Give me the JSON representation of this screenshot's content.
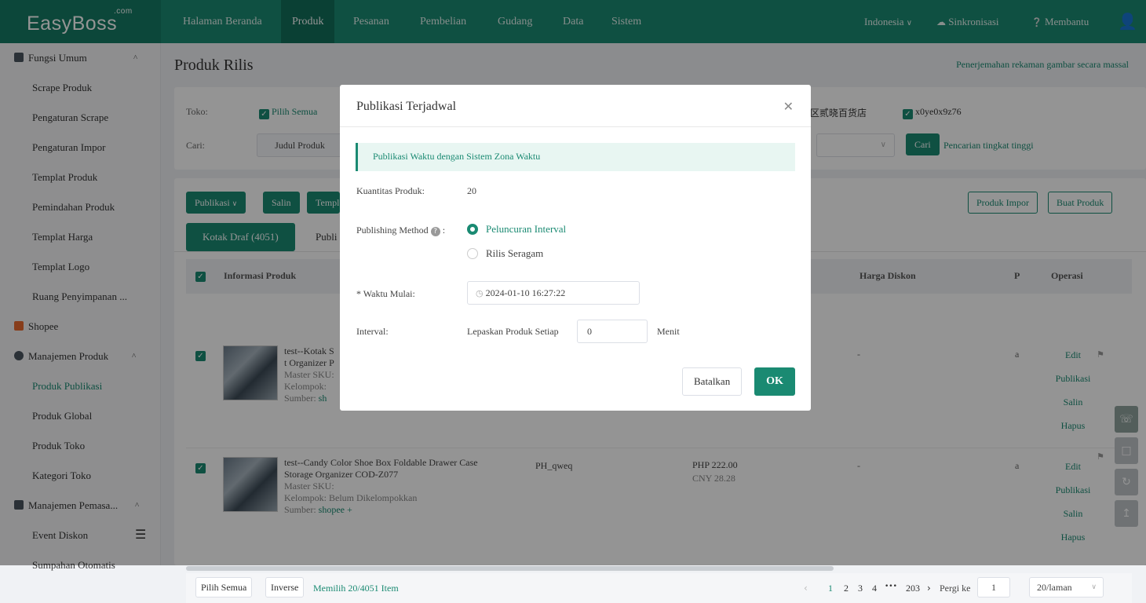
{
  "brand": {
    "name": "EasyBoss",
    "suffix": ".com"
  },
  "nav": {
    "items": [
      "Halaman Beranda",
      "Produk",
      "Pesanan",
      "Pembelian",
      "Gudang",
      "Data",
      "Sistem"
    ],
    "active": "Produk",
    "language": "Indonesia",
    "sync": "Sinkronisasi",
    "help": "Membantu"
  },
  "sidebar": {
    "groups": [
      {
        "label": "Fungsi Umum",
        "items": [
          "Scrape Produk",
          "Pengaturan Scrape",
          "Pengaturan Impor",
          "Templat Produk",
          "Pemindahan Produk",
          "Templat Harga",
          "Templat Logo",
          "Ruang Penyimpanan ..."
        ]
      },
      {
        "label": "Shopee",
        "items": []
      },
      {
        "label": "Manajemen Produk",
        "items": [
          "Produk Publikasi",
          "Produk Global",
          "Produk Toko",
          "Kategori Toko"
        ]
      },
      {
        "label": "Manajemen Pemasa...",
        "items": [
          "Event Diskon",
          "Sumpahan Otomatis"
        ]
      }
    ],
    "active": "Produk Publikasi"
  },
  "page": {
    "title": "Produk Rilis",
    "top_link": "Penerjemahan rekaman gambar secara massal"
  },
  "filter": {
    "store_label": "Toko:",
    "select_all": "Pilih Semua",
    "store2": "区贰晓百货店",
    "store3": "x0ye0x9z76",
    "search_label": "Cari:",
    "search_field": "Judul Produk",
    "search_btn": "Cari",
    "advanced": "Pencarian tingkat tinggi"
  },
  "toolbar": {
    "publish": "Publikasi",
    "copy": "Salin",
    "template": "Templ",
    "import": "Produk Impor",
    "create": "Buat Produk"
  },
  "tabs": {
    "draft": "Kotak Draf (4051)",
    "pub": "Publi"
  },
  "table": {
    "headers": {
      "info": "Informasi Produk",
      "disc": "Harga Diskon",
      "p": "P",
      "ops": "Operasi"
    },
    "rows": [
      {
        "title": "test--Kotak S",
        "title2": "t Organizer P",
        "sku": "Master SKU:",
        "group": "Kelompok:",
        "source_label": "Sumber:",
        "source": "sh",
        "sku_code": "",
        "price": "",
        "cny": "",
        "disc": "-",
        "p": "a"
      },
      {
        "title": "test--Candy Color Shoe Box Foldable Drawer Case",
        "title2": "Storage Organizer COD-Z077",
        "sku": "Master SKU:",
        "group": "Kelompok:  Belum Dikelompokkan",
        "source_label": "Sumber:",
        "source": "shopee  +",
        "sku_code": "PH_qweq",
        "price": "PHP 222.00",
        "cny": "CNY 28.28",
        "disc": "-",
        "p": "a"
      }
    ],
    "ops": [
      "Edit",
      "Publikasi",
      "Salin",
      "Hapus"
    ]
  },
  "footer": {
    "select_all": "Pilih Semua",
    "inverse": "Inverse",
    "selected": "Memilih 20/4051 Item",
    "pages": [
      "1",
      "2",
      "3",
      "4",
      "•••",
      "203"
    ],
    "goto": "Pergi ke",
    "goto_val": "1",
    "per_page": "20/laman"
  },
  "modal": {
    "title": "Publikasi Terjadwal",
    "alert": "Publikasi Waktu dengan Sistem Zona Waktu",
    "qty_label": "Kuantitas Produk:",
    "qty": "20",
    "method_label": "Publishing Method",
    "method_opt1": "Peluncuran Interval",
    "method_opt2": "Rilis Seragam",
    "start_label": "* Waktu Mulai:",
    "start_value": "2024-01-10 16:27:22",
    "interval_label": "Interval:",
    "interval_prefix": "Lepaskan Produk Setiap",
    "interval_value": "0",
    "interval_unit": "Menit",
    "cancel": "Batalkan",
    "ok": "OK"
  },
  "colors": {
    "primary": "#1a8a72",
    "header": "#1a8a72"
  }
}
